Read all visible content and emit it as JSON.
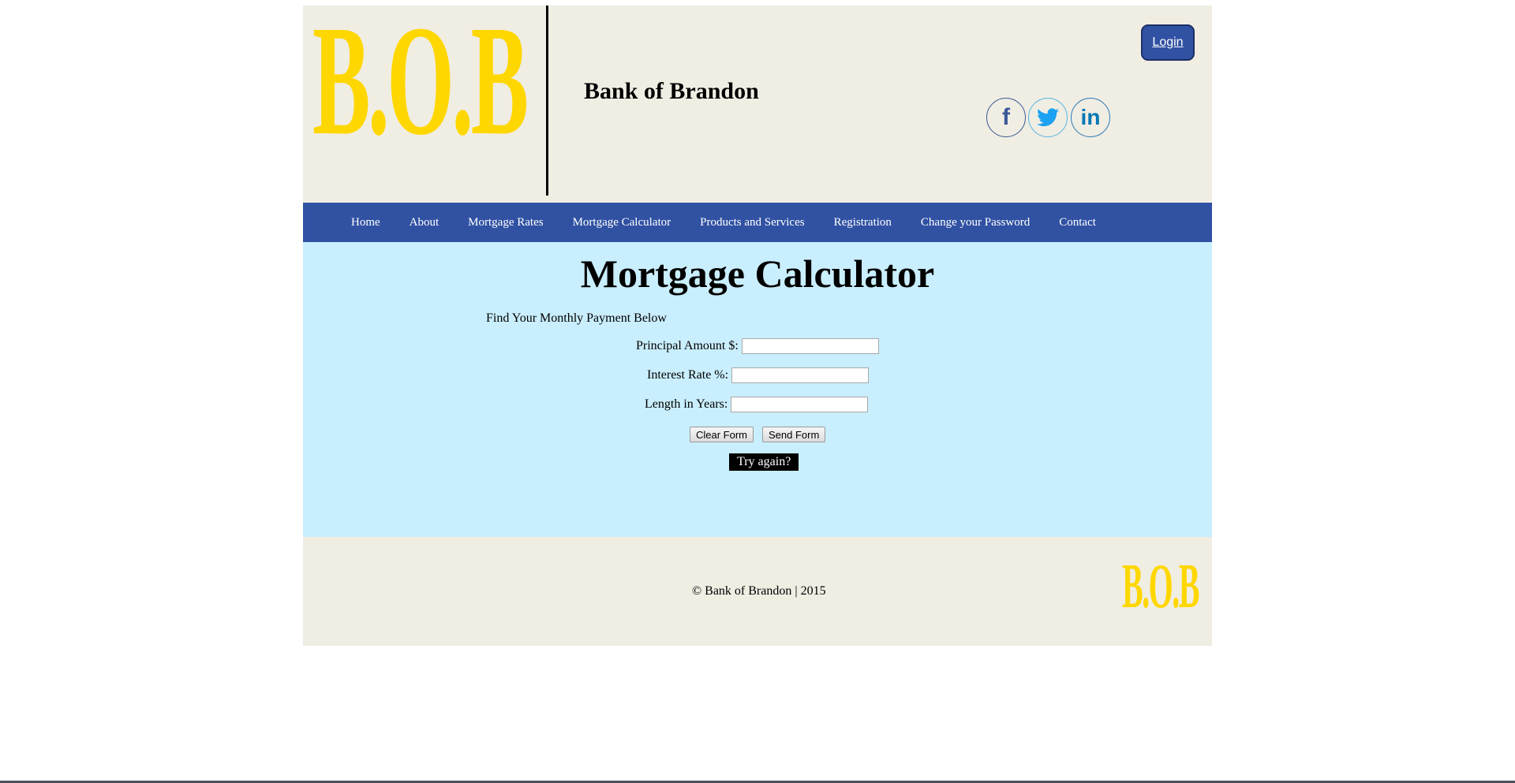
{
  "header": {
    "logo_text": "B.O.B",
    "bank_name": "Bank of Brandon",
    "login_label": "Login",
    "social": [
      {
        "name": "facebook",
        "glyph": "f"
      },
      {
        "name": "twitter",
        "glyph": "🐦"
      },
      {
        "name": "linkedin",
        "glyph": "in"
      }
    ]
  },
  "nav": {
    "items": [
      {
        "label": "Home"
      },
      {
        "label": "About"
      },
      {
        "label": "Mortgage Rates"
      },
      {
        "label": "Mortgage Calculator"
      },
      {
        "label": "Products and Services"
      },
      {
        "label": "Registration"
      },
      {
        "label": "Change your Password"
      },
      {
        "label": "Contact"
      }
    ]
  },
  "main": {
    "title": "Mortgage Calculator",
    "subtitle": "Find Your Monthly Payment Below",
    "fields": [
      {
        "label": "Principal Amount $:",
        "value": ""
      },
      {
        "label": "Interest Rate %:",
        "value": ""
      },
      {
        "label": "Length in Years:",
        "value": ""
      }
    ],
    "clear_label": "Clear Form",
    "send_label": "Send Form",
    "try_again_label": "Try again?"
  },
  "footer": {
    "copyright": "© Bank of Brandon | 2015",
    "logo_text": "B.O.B"
  },
  "colors": {
    "brand_blue": "#3152a3",
    "logo_yellow": "#ffd700",
    "header_bg": "#f0ede3",
    "main_bg": "#c9eefd"
  }
}
